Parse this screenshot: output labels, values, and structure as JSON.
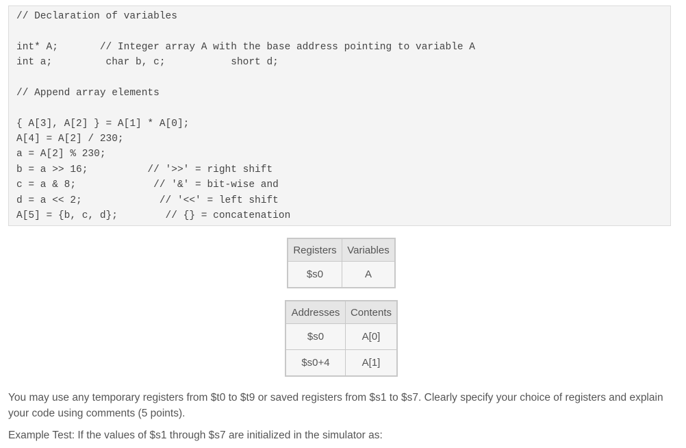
{
  "code": {
    "lines": [
      "// Declaration of variables",
      "int* A;       // Integer array A with the base address pointing to variable A",
      "int a;         char b, c;           short d;",
      "// Append array elements",
      "{ A[3], A[2] } = A[1] * A[0];",
      "A[4] = A[2] / 230;",
      "a = A[2] % 230;",
      "b = a >> 16;          // '>>' = right shift",
      "c = a & 8;             // '&' = bit-wise and",
      "d = a << 2;             // '<<' = left shift",
      "A[5] = {b, c, d};        // {} = concatenation"
    ]
  },
  "registers_table": {
    "headers": [
      "Registers",
      "Variables"
    ],
    "rows": [
      [
        "$s0",
        "A"
      ]
    ]
  },
  "memory_table": {
    "headers": [
      "Addresses",
      "Contents"
    ],
    "rows": [
      [
        "$s0",
        "A[0]"
      ],
      [
        "$s0+4",
        "A[1]"
      ]
    ]
  },
  "paragraphs": [
    "You may use any temporary registers from $t0 to $t9 or saved registers from $s1 to $s7. Clearly specify your choice of registers and explain your code using comments (5 points).",
    "Example Test: If the values of $s1 through $s7 are initialized in the simulator as:"
  ]
}
